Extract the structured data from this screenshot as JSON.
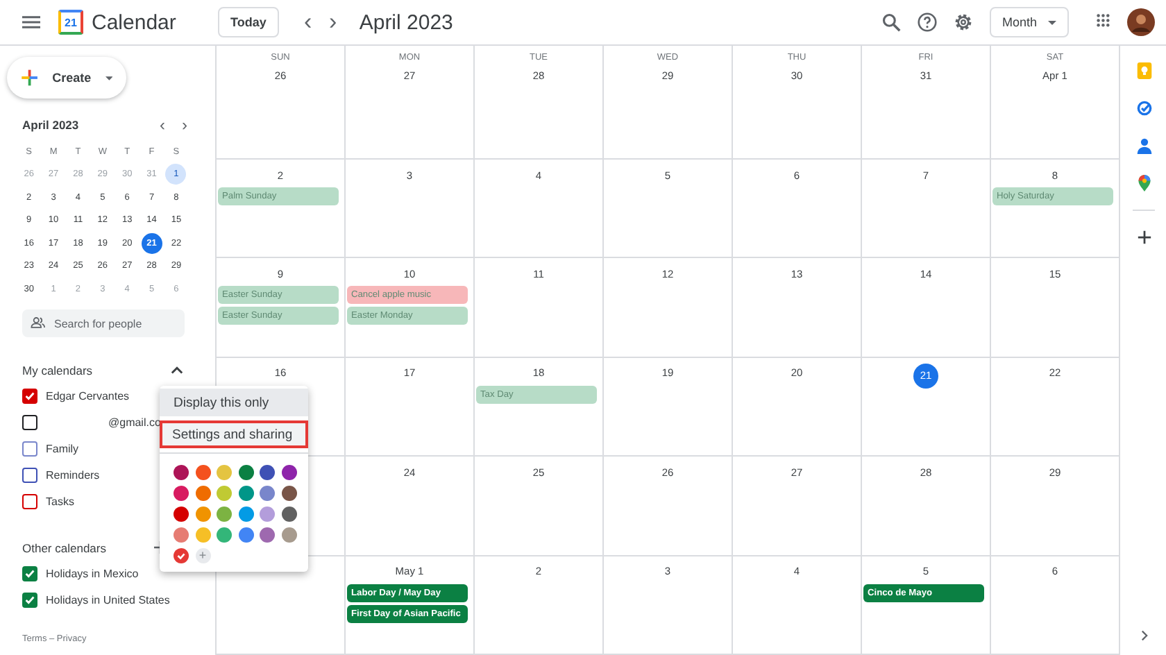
{
  "header": {
    "logo_day": "21",
    "app_name": "Calendar",
    "today_button": "Today",
    "prev": "‹",
    "next": "›",
    "title": "April 2023",
    "view_button": "Month"
  },
  "create_button": "Create",
  "mini_calendar": {
    "title": "April 2023",
    "weekdays": [
      "S",
      "M",
      "T",
      "W",
      "T",
      "F",
      "S"
    ],
    "days": [
      {
        "label": "26",
        "other_month": true,
        "today": false,
        "selected": false
      },
      {
        "label": "27",
        "other_month": true,
        "today": false,
        "selected": false
      },
      {
        "label": "28",
        "other_month": true,
        "today": false,
        "selected": false
      },
      {
        "label": "29",
        "other_month": true,
        "today": false,
        "selected": false
      },
      {
        "label": "30",
        "other_month": true,
        "today": false,
        "selected": false
      },
      {
        "label": "31",
        "other_month": true,
        "today": false,
        "selected": false
      },
      {
        "label": "1",
        "other_month": false,
        "today": false,
        "selected": true
      },
      {
        "label": "2",
        "other_month": false,
        "today": false,
        "selected": false
      },
      {
        "label": "3",
        "other_month": false,
        "today": false,
        "selected": false
      },
      {
        "label": "4",
        "other_month": false,
        "today": false,
        "selected": false
      },
      {
        "label": "5",
        "other_month": false,
        "today": false,
        "selected": false
      },
      {
        "label": "6",
        "other_month": false,
        "today": false,
        "selected": false
      },
      {
        "label": "7",
        "other_month": false,
        "today": false,
        "selected": false
      },
      {
        "label": "8",
        "other_month": false,
        "today": false,
        "selected": false
      },
      {
        "label": "9",
        "other_month": false,
        "today": false,
        "selected": false
      },
      {
        "label": "10",
        "other_month": false,
        "today": false,
        "selected": false
      },
      {
        "label": "11",
        "other_month": false,
        "today": false,
        "selected": false
      },
      {
        "label": "12",
        "other_month": false,
        "today": false,
        "selected": false
      },
      {
        "label": "13",
        "other_month": false,
        "today": false,
        "selected": false
      },
      {
        "label": "14",
        "other_month": false,
        "today": false,
        "selected": false
      },
      {
        "label": "15",
        "other_month": false,
        "today": false,
        "selected": false
      },
      {
        "label": "16",
        "other_month": false,
        "today": false,
        "selected": false
      },
      {
        "label": "17",
        "other_month": false,
        "today": false,
        "selected": false
      },
      {
        "label": "18",
        "other_month": false,
        "today": false,
        "selected": false
      },
      {
        "label": "19",
        "other_month": false,
        "today": false,
        "selected": false
      },
      {
        "label": "20",
        "other_month": false,
        "today": false,
        "selected": false
      },
      {
        "label": "21",
        "other_month": false,
        "today": true,
        "selected": false
      },
      {
        "label": "22",
        "other_month": false,
        "today": false,
        "selected": false
      },
      {
        "label": "23",
        "other_month": false,
        "today": false,
        "selected": false
      },
      {
        "label": "24",
        "other_month": false,
        "today": false,
        "selected": false
      },
      {
        "label": "25",
        "other_month": false,
        "today": false,
        "selected": false
      },
      {
        "label": "26",
        "other_month": false,
        "today": false,
        "selected": false
      },
      {
        "label": "27",
        "other_month": false,
        "today": false,
        "selected": false
      },
      {
        "label": "28",
        "other_month": false,
        "today": false,
        "selected": false
      },
      {
        "label": "29",
        "other_month": false,
        "today": false,
        "selected": false
      },
      {
        "label": "30",
        "other_month": false,
        "today": false,
        "selected": false
      },
      {
        "label": "1",
        "other_month": true,
        "today": false,
        "selected": false
      },
      {
        "label": "2",
        "other_month": true,
        "today": false,
        "selected": false
      },
      {
        "label": "3",
        "other_month": true,
        "today": false,
        "selected": false
      },
      {
        "label": "4",
        "other_month": true,
        "today": false,
        "selected": false
      },
      {
        "label": "5",
        "other_month": true,
        "today": false,
        "selected": false
      },
      {
        "label": "6",
        "other_month": true,
        "today": false,
        "selected": false
      }
    ]
  },
  "people_search": {
    "placeholder": "Search for people"
  },
  "my_calendars": {
    "title": "My calendars",
    "expanded": true,
    "items": [
      {
        "label": "Edgar Cervantes",
        "color": "#d50000",
        "checked": true
      },
      {
        "label": "@gmail.co",
        "color": "#202124",
        "checked": false
      },
      {
        "label": "Family",
        "color": "#7986cb",
        "checked": false
      },
      {
        "label": "Reminders",
        "color": "#3f51b5",
        "checked": false
      },
      {
        "label": "Tasks",
        "color": "#d50000",
        "checked": false
      }
    ]
  },
  "other_calendars": {
    "title": "Other calendars",
    "items": [
      {
        "label": "Holidays in Mexico",
        "color": "#0b8043",
        "checked": true
      },
      {
        "label": "Holidays in United States",
        "color": "#0b8043",
        "checked": true
      }
    ]
  },
  "footer": "Terms – Privacy",
  "weekdays": [
    "SUN",
    "MON",
    "TUE",
    "WED",
    "THU",
    "FRI",
    "SAT"
  ],
  "weeks": [
    {
      "days": [
        {
          "label": "26",
          "today": false
        },
        {
          "label": "27",
          "today": false
        },
        {
          "label": "28",
          "today": false
        },
        {
          "label": "29",
          "today": false
        },
        {
          "label": "30",
          "today": false
        },
        {
          "label": "31",
          "today": false
        },
        {
          "label": "Apr 1",
          "today": false
        }
      ]
    },
    {
      "days": [
        {
          "label": "2",
          "today": false,
          "events": [
            {
              "title": "Palm Sunday",
              "color": "#b7dcc7",
              "past": true
            }
          ]
        },
        {
          "label": "3",
          "today": false
        },
        {
          "label": "4",
          "today": false
        },
        {
          "label": "5",
          "today": false
        },
        {
          "label": "6",
          "today": false
        },
        {
          "label": "7",
          "today": false
        },
        {
          "label": "8",
          "today": false,
          "events": [
            {
              "title": "Holy Saturday",
              "color": "#b7dcc7",
              "past": true
            }
          ]
        }
      ]
    },
    {
      "days": [
        {
          "label": "9",
          "today": false,
          "events": [
            {
              "title": "Easter Sunday",
              "color": "#b7dcc7",
              "past": true
            },
            {
              "title": "Easter Sunday",
              "color": "#b7dcc7",
              "past": true
            }
          ]
        },
        {
          "label": "10",
          "today": false,
          "events": [
            {
              "title": "Cancel apple music",
              "color": "#f7b7b9",
              "past": true
            },
            {
              "title": "Easter Monday",
              "color": "#b7dcc7",
              "past": true
            }
          ]
        },
        {
          "label": "11",
          "today": false
        },
        {
          "label": "12",
          "today": false
        },
        {
          "label": "13",
          "today": false
        },
        {
          "label": "14",
          "today": false
        },
        {
          "label": "15",
          "today": false
        }
      ]
    },
    {
      "days": [
        {
          "label": "16",
          "today": false
        },
        {
          "label": "17",
          "today": false
        },
        {
          "label": "18",
          "today": false,
          "events": [
            {
              "title": "Tax Day",
              "color": "#b7dcc7",
              "past": true
            }
          ]
        },
        {
          "label": "19",
          "today": false
        },
        {
          "label": "20",
          "today": false
        },
        {
          "label": "21",
          "today": true
        },
        {
          "label": "22",
          "today": false
        }
      ]
    },
    {
      "first_day_covered": true,
      "days": [
        {
          "label": "24",
          "today": false
        },
        {
          "label": "25",
          "today": false
        },
        {
          "label": "26",
          "today": false
        },
        {
          "label": "27",
          "today": false
        },
        {
          "label": "28",
          "today": false
        },
        {
          "label": "29",
          "today": false
        }
      ]
    },
    {
      "first_day_covered": true,
      "days": [
        {
          "label": "May 1",
          "today": false,
          "events": [
            {
              "title": "Labor Day / May Day",
              "color": "#0b8043",
              "past": false
            },
            {
              "title": "First Day of Asian Pacific",
              "color": "#0b8043",
              "past": false
            }
          ]
        },
        {
          "label": "2",
          "today": false
        },
        {
          "label": "3",
          "today": false
        },
        {
          "label": "4",
          "today": false
        },
        {
          "label": "5",
          "today": false,
          "events": [
            {
              "title": "Cinco de Mayo",
              "color": "#0b8043",
              "past": false
            }
          ]
        },
        {
          "label": "6",
          "today": false
        }
      ]
    }
  ],
  "context_menu": {
    "items": [
      {
        "label": "Display this only",
        "selected": false,
        "hovered": true
      },
      {
        "label": "Settings and sharing",
        "selected": true,
        "hovered": false
      }
    ],
    "swatches": [
      {
        "color": "#ad1457",
        "selected": false
      },
      {
        "color": "#f4511e",
        "selected": false
      },
      {
        "color": "#e4c441",
        "selected": false
      },
      {
        "color": "#0b8043",
        "selected": false
      },
      {
        "color": "#3f51b5",
        "selected": false
      },
      {
        "color": "#8e24aa",
        "selected": false
      },
      {
        "color": "#d81b60",
        "selected": false
      },
      {
        "color": "#ef6c00",
        "selected": false
      },
      {
        "color": "#c0ca33",
        "selected": false
      },
      {
        "color": "#009688",
        "selected": false
      },
      {
        "color": "#7986cb",
        "selected": false
      },
      {
        "color": "#795548",
        "selected": false
      },
      {
        "color": "#d50000",
        "selected": false
      },
      {
        "color": "#f09300",
        "selected": false
      },
      {
        "color": "#7cb342",
        "selected": false
      },
      {
        "color": "#039be5",
        "selected": false
      },
      {
        "color": "#b39ddb",
        "selected": false
      },
      {
        "color": "#616161",
        "selected": false
      },
      {
        "color": "#e67c73",
        "selected": false
      },
      {
        "color": "#f6bf26",
        "selected": false
      },
      {
        "color": "#33b679",
        "selected": false
      },
      {
        "color": "#4285f4",
        "selected": false
      },
      {
        "color": "#9e69af",
        "selected": false
      },
      {
        "color": "#a79b8e",
        "selected": false
      },
      {
        "color": "#e53935",
        "selected": true
      }
    ],
    "add_symbol": "+"
  }
}
